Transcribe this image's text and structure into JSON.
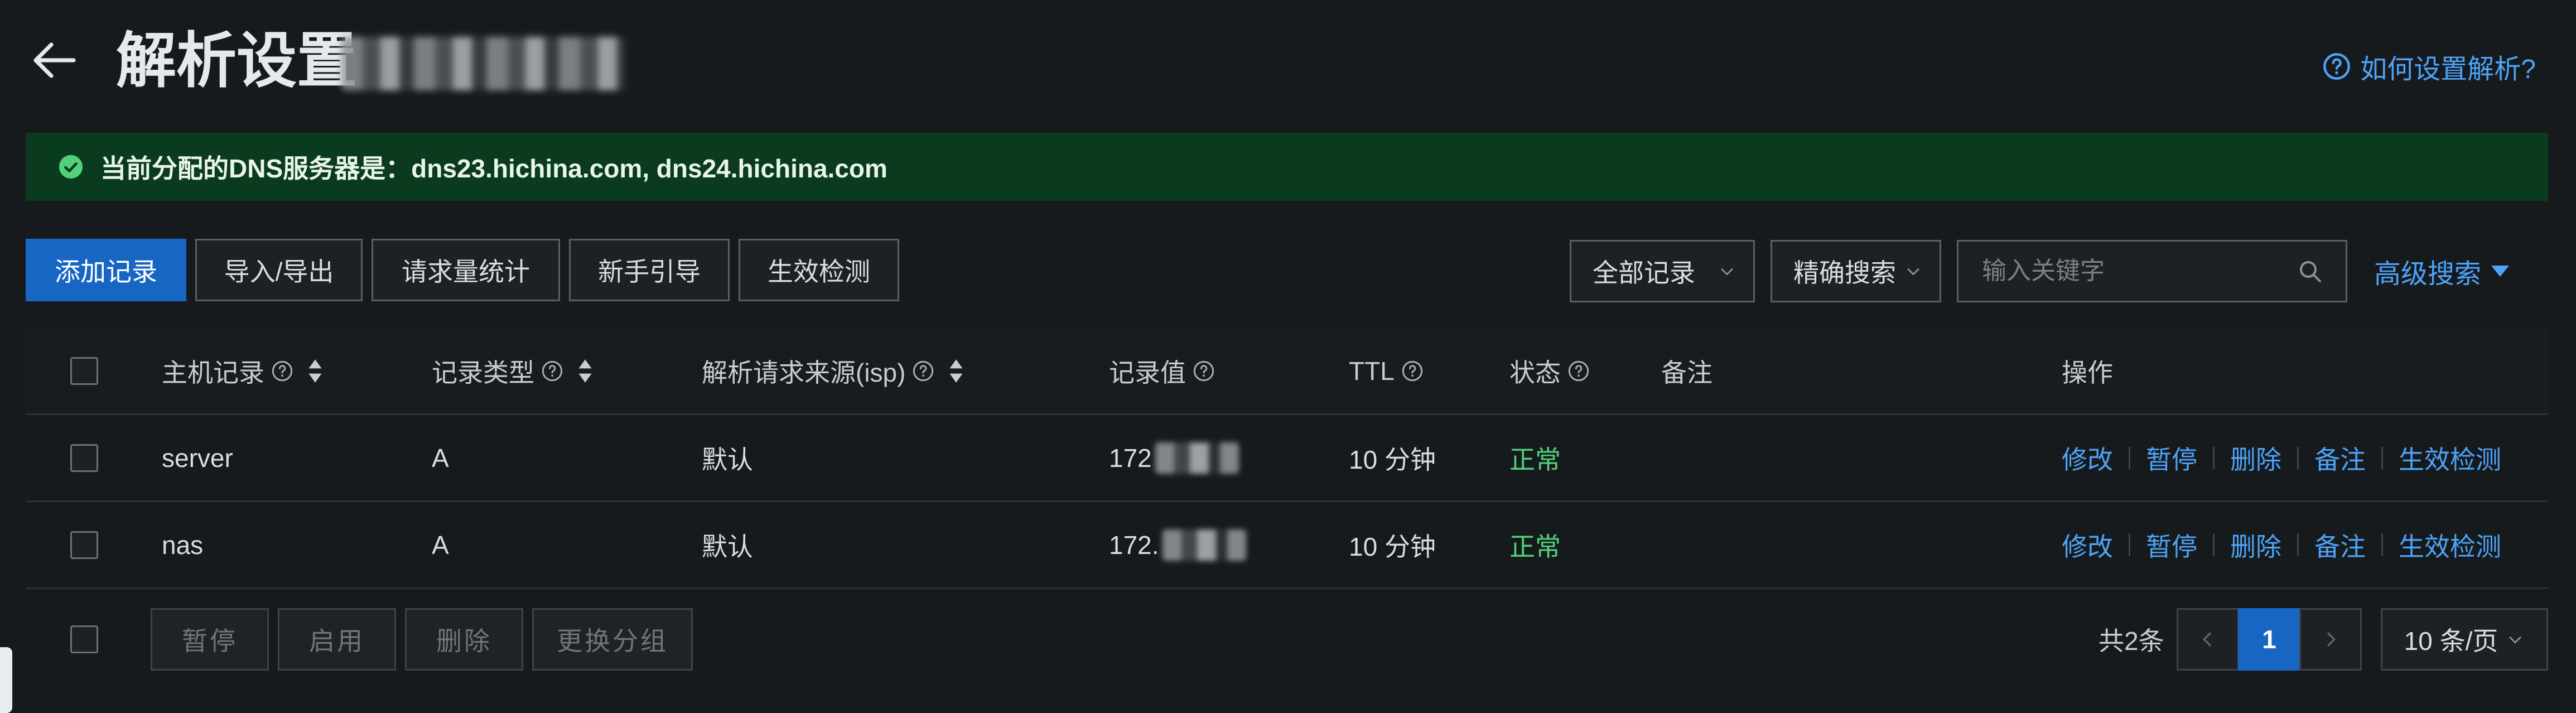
{
  "header": {
    "title": "解析设置",
    "help_link": "如何设置解析?"
  },
  "alert": {
    "text": "当前分配的DNS服务器是：dns23.hichina.com, dns24.hichina.com"
  },
  "toolbar": {
    "add_record": "添加记录",
    "import_export": "导入/导出",
    "request_stats": "请求量统计",
    "beginner_guide": "新手引导",
    "effect_check": "生效检测",
    "record_filter": "全部记录",
    "search_mode": "精确搜索",
    "search_placeholder": "输入关键字",
    "advanced_search": "高级搜索"
  },
  "table": {
    "columns": {
      "host": "主机记录",
      "type": "记录类型",
      "isp": "解析请求来源(isp)",
      "value": "记录值",
      "ttl": "TTL",
      "status": "状态",
      "remark": "备注",
      "actions": "操作"
    },
    "rows": [
      {
        "host": "server",
        "type": "A",
        "isp": "默认",
        "value": "172",
        "ttl": "10 分钟",
        "status": "正常"
      },
      {
        "host": "nas",
        "type": "A",
        "isp": "默认",
        "value": "172.",
        "ttl": "10 分钟",
        "status": "正常"
      }
    ],
    "actions": {
      "modify": "修改",
      "pause": "暂停",
      "delete": "删除",
      "remark": "备注",
      "check": "生效检测"
    }
  },
  "footer": {
    "pause": "暂停",
    "enable": "启用",
    "delete": "删除",
    "change_group": "更换分组",
    "total": "共2条",
    "current_page": "1",
    "page_size": "10 条/页"
  },
  "colors": {
    "accent": "#1766c4",
    "link": "#4da3f7",
    "success_bg": "#0b3b1f",
    "status_ok": "#52d17a"
  },
  "icons": [
    "back-arrow-icon",
    "help-icon",
    "check-circle-icon",
    "chevron-down-icon",
    "search-icon",
    "triangle-down-icon",
    "question-icon",
    "sort-icon",
    "chevron-left-icon",
    "chevron-right-icon"
  ]
}
